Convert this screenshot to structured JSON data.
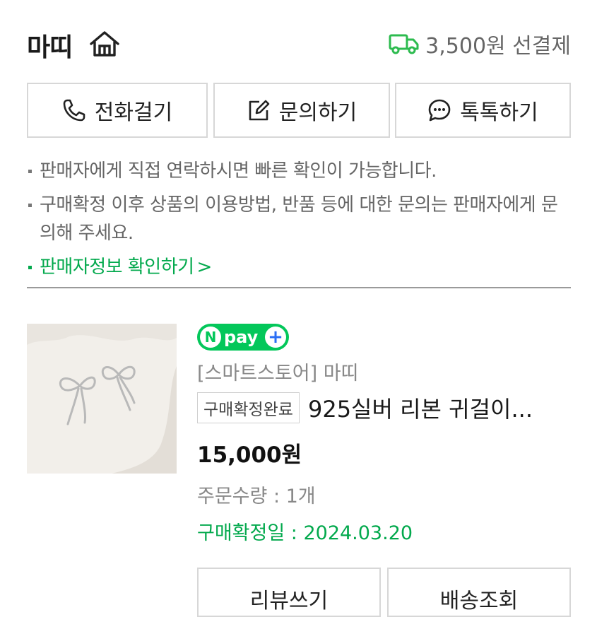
{
  "header": {
    "store_name": "마띠",
    "shipping_text": "3,500원 선결제"
  },
  "actions": {
    "call": "전화걸기",
    "inquiry": "문의하기",
    "talk": "톡톡하기"
  },
  "notices": {
    "line1": "판매자에게 직접 연락하시면 빠른 확인이 가능합니다.",
    "line2": "구매확정 이후 상품의 이용방법, 반품 등에 대한 문의는 판매자에게 문의해 주세요.",
    "seller_info_link": "판매자정보 확인하기",
    "chevron": ">"
  },
  "product": {
    "npay_n": "N",
    "npay_text": "pay",
    "npay_plus": "+",
    "store_label": "[스마트스토어] 마띠",
    "status_badge": "구매확정완료",
    "name": "925실버 리본 귀걸이...",
    "price": "15,000원",
    "quantity": "주문수량 : 1개",
    "confirm_date": "구매확정일 : 2024.03.20"
  },
  "bottom_actions": {
    "review": "리뷰쓰기",
    "shipping_track": "배송조회"
  },
  "colors": {
    "accent_green": "#03c75a",
    "link_green": "#03a94d",
    "npay_plus_blue": "#2b6ef5"
  },
  "icons": [
    "home-icon",
    "truck-icon",
    "phone-icon",
    "edit-icon",
    "chat-bubble-icon"
  ]
}
